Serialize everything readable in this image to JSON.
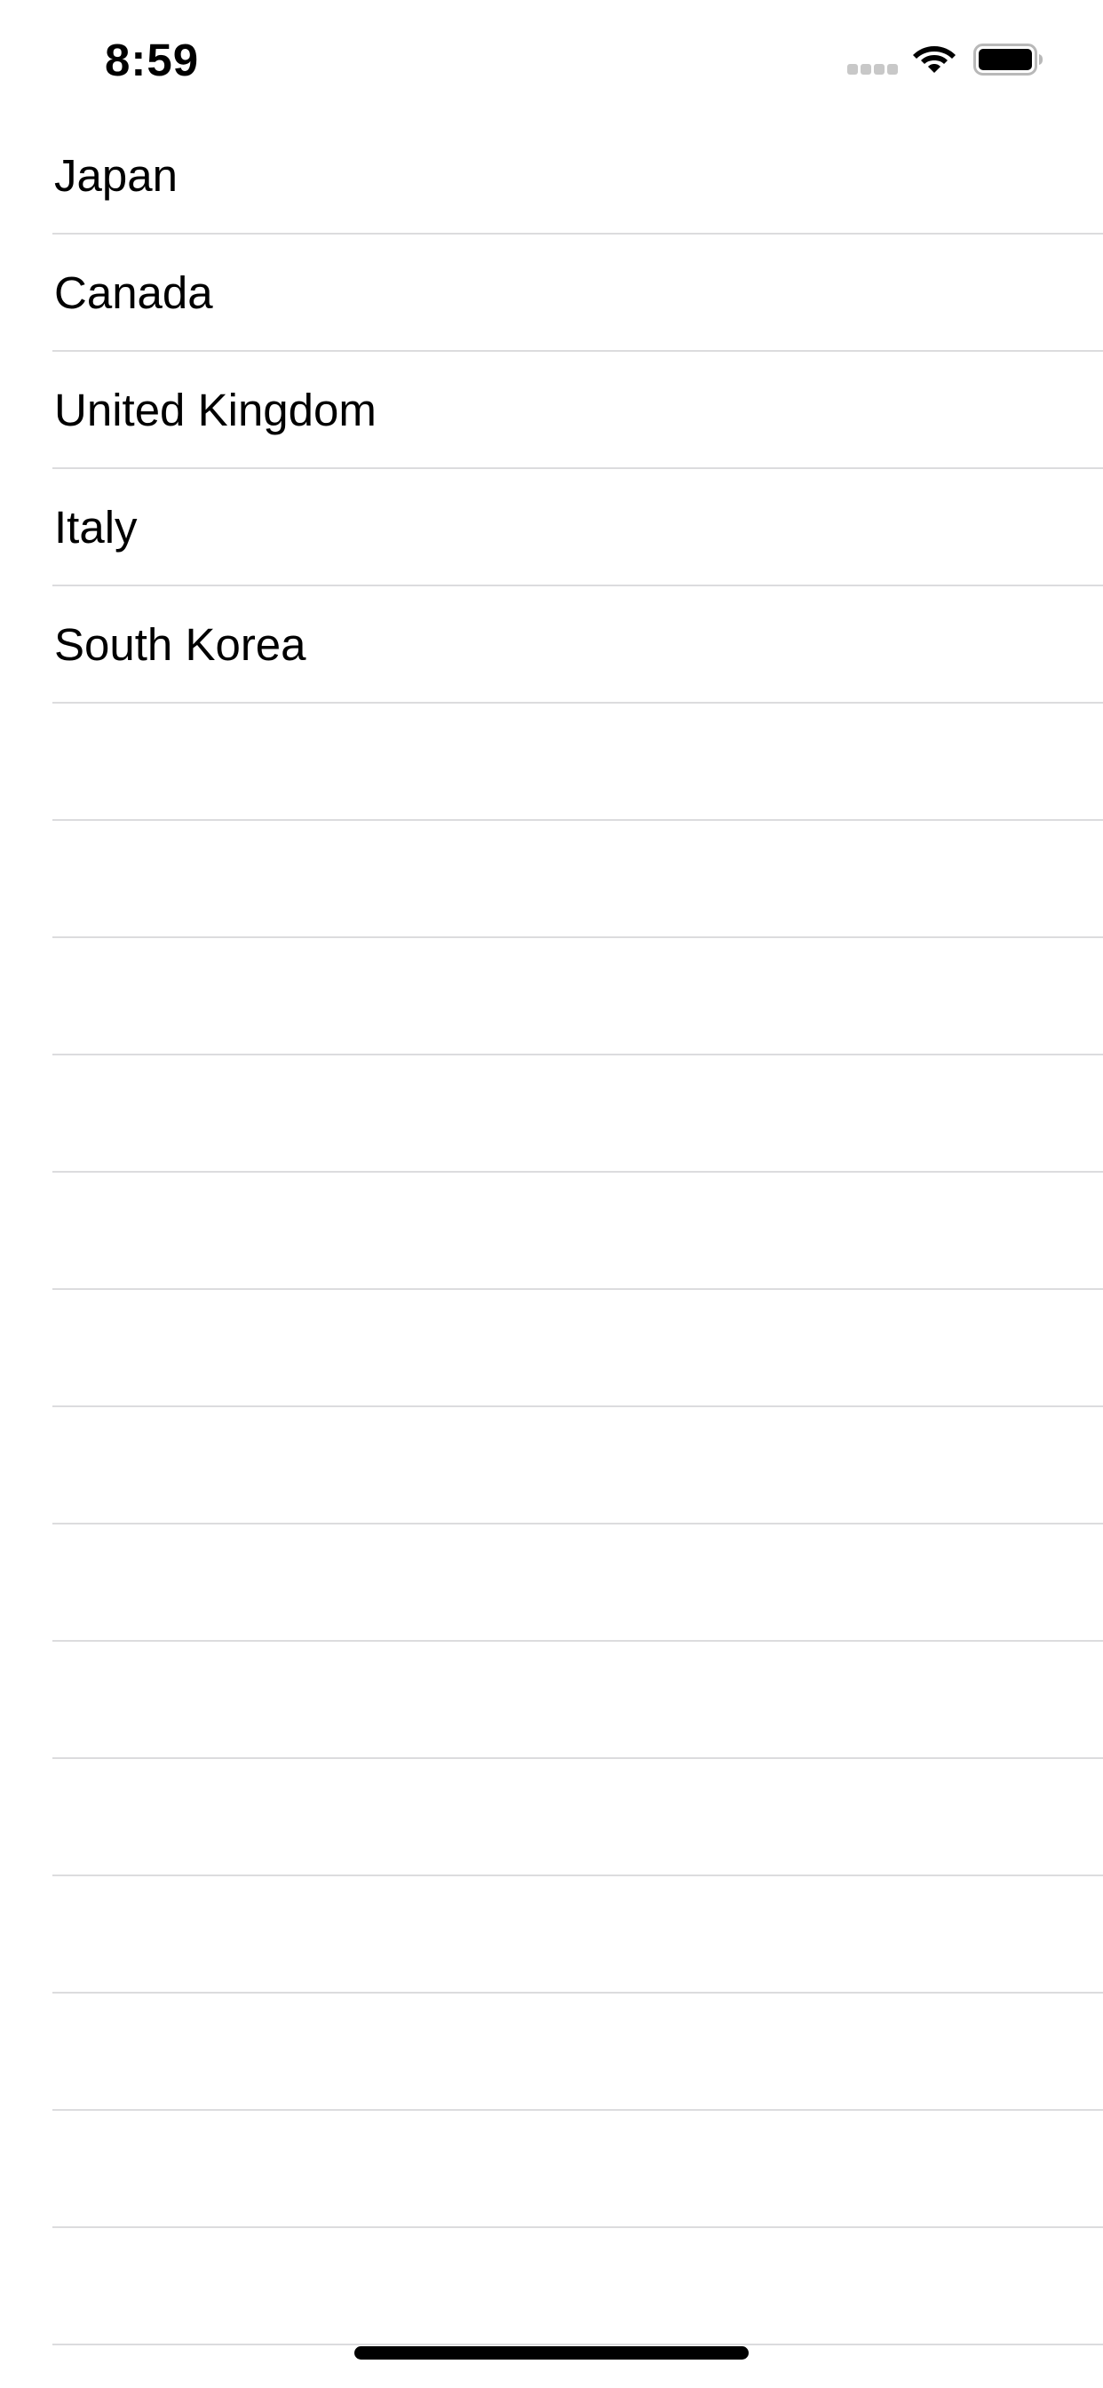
{
  "status_bar": {
    "time": "8:59",
    "signal_icon": "cellular-signal-icon",
    "wifi_icon": "wifi-icon",
    "battery_icon": "battery-icon"
  },
  "table": {
    "rows": [
      {
        "label": "Japan"
      },
      {
        "label": "Canada"
      },
      {
        "label": "United Kingdom"
      },
      {
        "label": "Italy"
      },
      {
        "label": "South Korea"
      },
      {
        "label": ""
      },
      {
        "label": ""
      },
      {
        "label": ""
      },
      {
        "label": ""
      },
      {
        "label": ""
      },
      {
        "label": ""
      },
      {
        "label": ""
      },
      {
        "label": ""
      },
      {
        "label": ""
      },
      {
        "label": ""
      },
      {
        "label": ""
      },
      {
        "label": ""
      },
      {
        "label": ""
      },
      {
        "label": ""
      }
    ]
  },
  "colors": {
    "background": "#ffffff",
    "text": "#000000",
    "separator": "#dcdcde",
    "signal_inactive": "#c8c8c8"
  }
}
